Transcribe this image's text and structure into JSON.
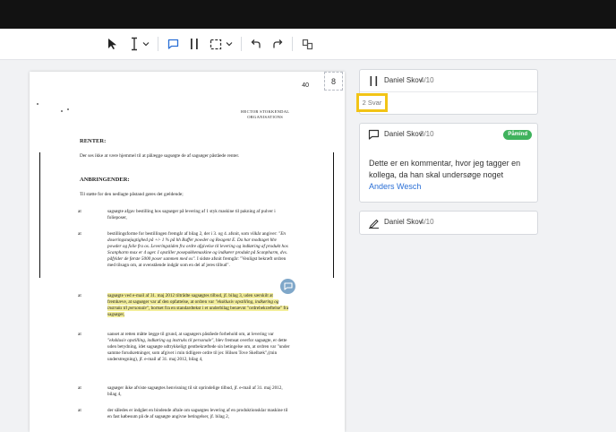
{
  "document": {
    "page_number": "40",
    "logo_line1": "HECTOR STOKKENDAL",
    "logo_line2": "ORGANISATIONS",
    "heading_renter": "RENTER:",
    "renter_text": "Der ses ikke at være hjemmel til at pålægge sagsøgte de af sagsøger påståede renter.",
    "heading_anbringender": "ANBRINGENDER:",
    "anbringender_intro": "Til støtte for den nedlagte påstand gøres det gældende;",
    "items": [
      {
        "marker": "at",
        "text": "sagsøgte afgav bestilling hos sagsøger på levering af 1 styk maskine til pakning af pulver i folieposer,"
      },
      {
        "marker": "at",
        "text_plain": "bestillingsforme for bestillingen fremgår af bilag 2, der i 3. og 4. afsnit, som vilkår angiver: ",
        "text_italic": "\"En doseringsnøjagtighed på +/- 1 % på hh Buffer powder og Reagent E. Da har modtaget hhv powder og folie fra os. Leveringstiden fra ordre afgivelse til levering og indkøring af produkt hos Scanpharm max er 4 uger. I opstiller posepakkemaskine og indkører produkt på Scanpharm, dvs. påfylder de første 5000 poser sammen med os\".",
        "text_rest": " I sidste afsnit fremgår: \"Venligst bekræft ordren med tilsagn om, at ovenstående indgår som en del af jeres tilbud\"."
      },
      {
        "marker": "at",
        "text_hl": "sagsøgte ved e-mail af 31. maj 2012 tiltrådte sagsøgtes tilbud, jf. bilag 3, uden særskilt at fremhæve, at sagsøger var af den opfattelse, at ordren var ",
        "text_hl_italic": "\"eksklusiv opstilling, indkøring og instruks til personale\"",
        "text_hl_rest": ", bortset fra en standardtekst i et underbilag benævnt \"ordrebekræftelse\" fra sagsøger,"
      },
      {
        "marker": "at",
        "text_plain": "uanset at retten måtte lægge til grund, at sagsøgers påståede forbehold om, at levering var ",
        "text_italic": "\"eksklusiv opstilling, indkøring og instruks til personale\"",
        "text_rest": ", blev fremsat overfor sagsøgte, er dette uden betydning, idet sagsøgte udtrykkeligt gentbekræftede sin betingelse om, at ordren var \"under samme forudsætninger, som afgivet i min tidligere ordre til jer. Hilsen Tove Skelbæk\",(min understregning), jf. e-mail af 31. maj 2012, bilag 4,"
      },
      {
        "marker": "at",
        "text": "sagsøger ikke afviste sagsøgtes henvisning til sit oprindelige tilbud, jf. e-mail af 31. maj 2012, bilag 4,"
      },
      {
        "marker": "at",
        "text": "der således er indgået en bindende aftale om sagsøgtes levering af en produktionsklar maskine til en fast købesum på de af sagsøgte angivne betingelser, jf. bilag 2,"
      }
    ]
  },
  "page_indicator": "8",
  "comments": [
    {
      "icon": "pause-markup-icon",
      "author": "Daniel Skov",
      "date": "4/10",
      "replies": "2 Svar"
    },
    {
      "icon": "comment-icon",
      "author": "Daniel Skov",
      "date": "8/10",
      "badge": "Påmind",
      "badge_color": "#3fb25d",
      "body": "Dette er en kommentar, hvor jeg tagger en kollega, da han skal undersøge noget ",
      "mention": "Anders Wesch"
    },
    {
      "icon": "signature-icon",
      "author": "Daniel Skov",
      "date": "4/10"
    }
  ],
  "colors": {
    "accent": "#2a6fd6",
    "highlight": "#f3ee9a",
    "focus_outline": "#f2c416",
    "topbar": "#121212"
  }
}
